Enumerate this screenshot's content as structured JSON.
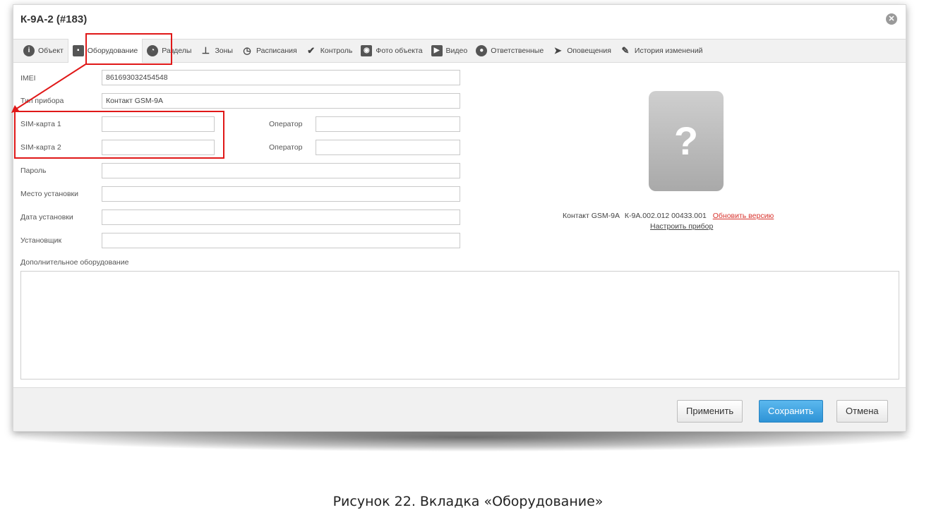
{
  "window": {
    "title": "К-9А-2 (#183)"
  },
  "tabs": [
    {
      "label": "Объект",
      "icon": "info-icon"
    },
    {
      "label": "Оборудование",
      "icon": "chip-icon",
      "active": true
    },
    {
      "label": "Разделы",
      "icon": "pie-chart-icon"
    },
    {
      "label": "Зоны",
      "icon": "hierarchy-icon"
    },
    {
      "label": "Расписания",
      "icon": "clock-icon"
    },
    {
      "label": "Контроль",
      "icon": "checkmark-icon"
    },
    {
      "label": "Фото объекта",
      "icon": "camera-icon"
    },
    {
      "label": "Видео",
      "icon": "video-camera-icon"
    },
    {
      "label": "Ответственные",
      "icon": "users-icon"
    },
    {
      "label": "Оповещения",
      "icon": "paper-plane-icon"
    },
    {
      "label": "История изменений",
      "icon": "edit-icon"
    }
  ],
  "form": {
    "imei": {
      "label": "IMEI",
      "value": "861693032454548"
    },
    "device_type": {
      "label": "Тип прибора",
      "value": "Контакт GSM-9А"
    },
    "sim1": {
      "label": "SIM-карта 1",
      "value": "",
      "operator_label": "Оператор",
      "operator_value": ""
    },
    "sim2": {
      "label": "SIM-карта 2",
      "value": "",
      "operator_label": "Оператор",
      "operator_value": ""
    },
    "password": {
      "label": "Пароль",
      "value": ""
    },
    "install_place": {
      "label": "Место установки",
      "value": ""
    },
    "install_date": {
      "label": "Дата установки",
      "value": ""
    },
    "installer": {
      "label": "Установщик",
      "value": ""
    },
    "extra_equipment": {
      "label": "Дополнительное оборудование",
      "value": ""
    }
  },
  "device_panel": {
    "preview_symbol": "?",
    "device_name": "Контакт GSM-9А",
    "version": "К-9А.002.012 00433.001",
    "update_link": "Обновить версию",
    "configure_link": "Настроить прибор"
  },
  "footer": {
    "apply_label": "Применить",
    "save_label": "Сохранить",
    "cancel_label": "Отмена"
  },
  "caption": "Рисунок 22. Вкладка «Оборудование»",
  "colors": {
    "highlight": "#e01818",
    "primary_button": "#2e93d6",
    "link_red": "#d8332d"
  }
}
